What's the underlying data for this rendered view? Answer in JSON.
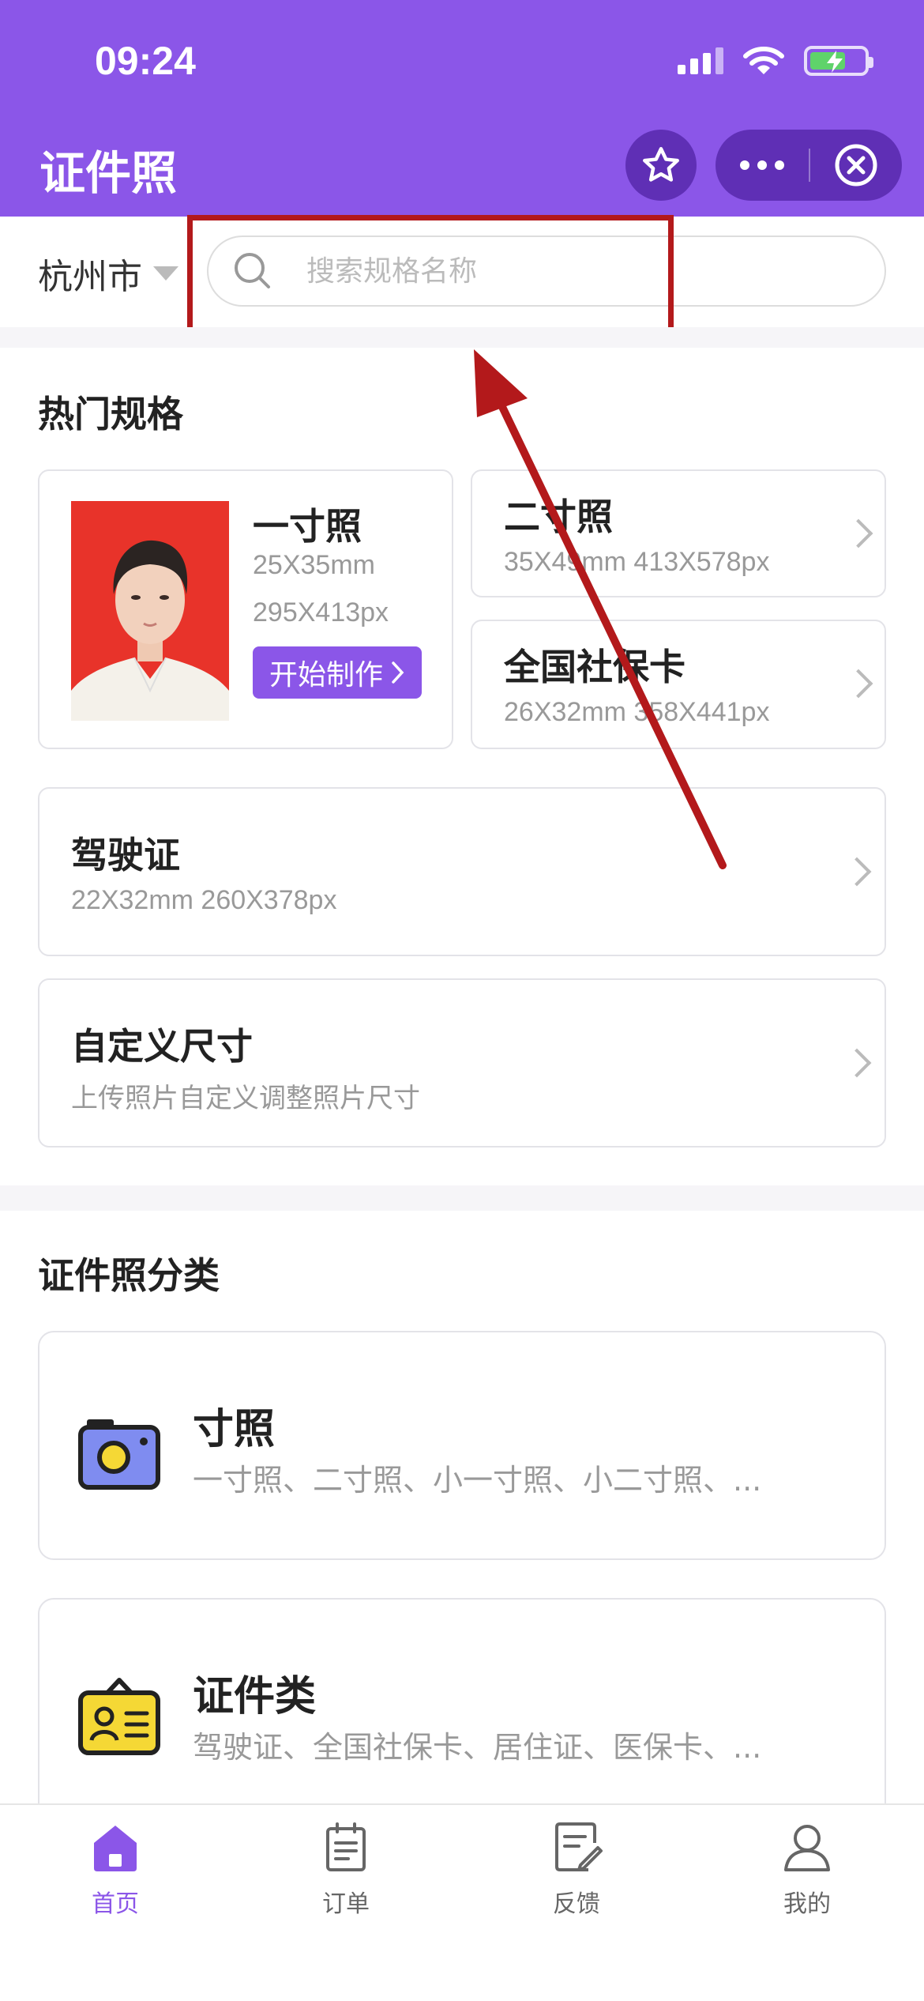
{
  "status_bar": {
    "time": "09:24"
  },
  "header": {
    "title": "证件照"
  },
  "search": {
    "city": "杭州市",
    "placeholder": "搜索规格名称"
  },
  "hot_section": {
    "title": "热门规格",
    "featured": {
      "name": "一寸照",
      "spec_mm": "25X35mm",
      "spec_px": "295X413px",
      "button_label": "开始制作"
    },
    "items": [
      {
        "name": "二寸照",
        "spec": "35X49mm 413X578px"
      },
      {
        "name": "全国社保卡",
        "spec": "26X32mm 358X441px"
      },
      {
        "name": "驾驶证",
        "spec": "22X32mm 260X378px"
      },
      {
        "name": "自定义尺寸",
        "spec": "上传照片自定义调整照片尺寸"
      }
    ]
  },
  "category_section": {
    "title": "证件照分类",
    "items": [
      {
        "name": "寸照",
        "desc": "一寸照、二寸照、小一寸照、小二寸照、...",
        "icon": "camera-icon"
      },
      {
        "name": "证件类",
        "desc": "驾驶证、全国社保卡、居住证、医保卡、...",
        "icon": "id-card-icon"
      }
    ]
  },
  "tabbar": {
    "items": [
      {
        "label": "首页",
        "icon": "home-icon",
        "active": true
      },
      {
        "label": "订单",
        "icon": "order-icon",
        "active": false
      },
      {
        "label": "反馈",
        "icon": "feedback-icon",
        "active": false
      },
      {
        "label": "我的",
        "icon": "profile-icon",
        "active": false
      }
    ]
  },
  "colors": {
    "brand": "#8b56e8",
    "capsule": "#5f2fb5",
    "annotation": "#b3191b",
    "photo_bg": "#e8332a"
  }
}
